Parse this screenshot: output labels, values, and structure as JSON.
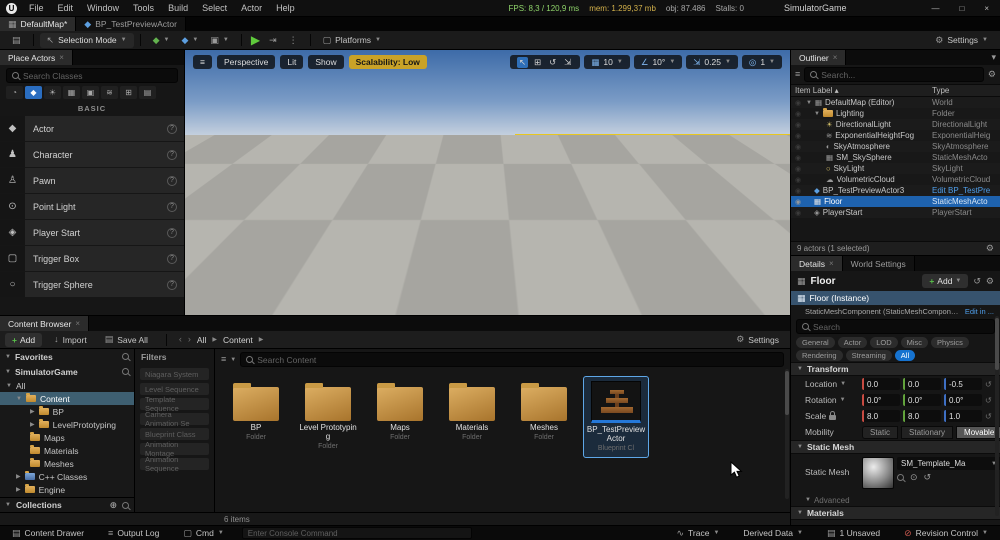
{
  "menubar": {
    "menus": [
      "File",
      "Edit",
      "Window",
      "Tools",
      "Build",
      "Select",
      "Actor",
      "Help"
    ],
    "fps": "FPS: 8,3  /  120,9 ms",
    "mem": "mem: 1.299,37 mb",
    "obj": "obj: 87.486",
    "stalls": "Stalls: 0",
    "app_title": "SimulatorGame"
  },
  "tabbar": {
    "map_tab": "DefaultMap*",
    "bp_tab": "BP_TestPreviewActor"
  },
  "toolbar": {
    "mode": "Selection Mode",
    "platforms": "Platforms",
    "settings": "Settings"
  },
  "place_actors": {
    "tab": "Place Actors",
    "search_placeholder": "Search Classes",
    "category": "BASIC",
    "items": [
      {
        "icon": "◆",
        "label": "Actor"
      },
      {
        "icon": "♟",
        "label": "Character"
      },
      {
        "icon": "♙",
        "label": "Pawn"
      },
      {
        "icon": "⊙",
        "label": "Point Light"
      },
      {
        "icon": "◈",
        "label": "Player Start"
      },
      {
        "icon": "▢",
        "label": "Trigger Box"
      },
      {
        "icon": "○",
        "label": "Trigger Sphere"
      }
    ]
  },
  "viewport": {
    "perspective": "Perspective",
    "lit": "Lit",
    "show": "Show",
    "scalability": "Scalability: Low",
    "snap_grid": "10",
    "snap_rotation": "10°",
    "snap_scale": "0.25",
    "camera_speed": "1"
  },
  "outliner": {
    "tab": "Outliner",
    "search_placeholder": "Search...",
    "col_item": "Item Label",
    "col_type": "Type",
    "rows": [
      {
        "label": "DefaultMap (Editor)",
        "type": "World"
      },
      {
        "label": "Lighting",
        "type": "Folder"
      },
      {
        "label": "DirectionalLight",
        "type": "DirectionalLight"
      },
      {
        "label": "ExponentialHeightFog",
        "type": "ExponentialHeig"
      },
      {
        "label": "SkyAtmosphere",
        "type": "SkyAtmosphere"
      },
      {
        "label": "SM_SkySphere",
        "type": "StaticMeshActo"
      },
      {
        "label": "SkyLight",
        "type": "SkyLight"
      },
      {
        "label": "VolumetricCloud",
        "type": "VolumetricCloud"
      },
      {
        "label": "BP_TestPreviewActor3",
        "type": "Edit BP_TestPre"
      },
      {
        "label": "Floor",
        "type": "StaticMeshActo"
      },
      {
        "label": "PlayerStart",
        "type": "PlayerStart"
      }
    ],
    "footer": "9 actors (1 selected)"
  },
  "details": {
    "tab": "Details",
    "tab_world": "World Settings",
    "title": "Floor",
    "add_label": "Add",
    "instance_row": "Floor (Instance)",
    "component_row": "StaticMeshComponent (StaticMeshComponent0)",
    "component_link": "Edit in ...",
    "search_placeholder": "Search",
    "filters_row1": [
      "General",
      "Actor",
      "LOD",
      "Misc",
      "Physics"
    ],
    "filters_row2": [
      "Rendering",
      "Streaming",
      "All"
    ],
    "transform": {
      "section": "Transform",
      "location_label": "Location",
      "location": [
        "0.0",
        "0.0",
        "-0.5"
      ],
      "rotation_label": "Rotation",
      "rotation": [
        "0.0°",
        "0.0°",
        "0.0°"
      ],
      "scale_label": "Scale",
      "scale": [
        "8.0",
        "8.0",
        "1.0"
      ],
      "mobility_label": "Mobility",
      "mobility_options": [
        "Static",
        "Stationary",
        "Movable"
      ]
    },
    "static_mesh": {
      "section": "Static Mesh",
      "label": "Static Mesh",
      "value": "SM_Template_Ma"
    },
    "advanced": "Advanced",
    "materials": "Materials"
  },
  "content_browser": {
    "tab": "Content Browser",
    "add": "Add",
    "import": "Import",
    "save_all": "Save All",
    "breadcrumb_all": "All",
    "breadcrumb_content": "Content",
    "settings": "Settings",
    "favorites": "Favorites",
    "project": "SimulatorGame",
    "tree": [
      {
        "label": "All"
      },
      {
        "label": "Content"
      },
      {
        "label": "BP"
      },
      {
        "label": "LevelPrototyping"
      },
      {
        "label": "Maps"
      },
      {
        "label": "Materials"
      },
      {
        "label": "Meshes"
      },
      {
        "label": "C++ Classes"
      },
      {
        "label": "Engine"
      }
    ],
    "collections": "Collections",
    "filters_title": "Filters",
    "filters": [
      "Niagara System",
      "Level Sequence",
      "Template Sequence",
      "Camera Animation Se",
      "Blueprint Class",
      "Animation Montage",
      "Animation Sequence"
    ],
    "search_placeholder": "Search Content",
    "assets": [
      {
        "name": "BP",
        "sub": "Folder"
      },
      {
        "name": "Level Prototyping",
        "sub": "Folder"
      },
      {
        "name": "Maps",
        "sub": "Folder"
      },
      {
        "name": "Materials",
        "sub": "Folder"
      },
      {
        "name": "Meshes",
        "sub": "Folder"
      },
      {
        "name": "BP_TestPreviewActor",
        "sub": "Blueprint Cl"
      }
    ],
    "items_count": "6 items"
  },
  "status_bar": {
    "content_drawer": "Content Drawer",
    "output_log": "Output Log",
    "cmd": "Cmd",
    "console_placeholder": "Enter Console Command",
    "trace": "Trace",
    "derived_data": "Derived Data",
    "unsaved": "1 Unsaved",
    "revision_control": "Revision Control"
  }
}
